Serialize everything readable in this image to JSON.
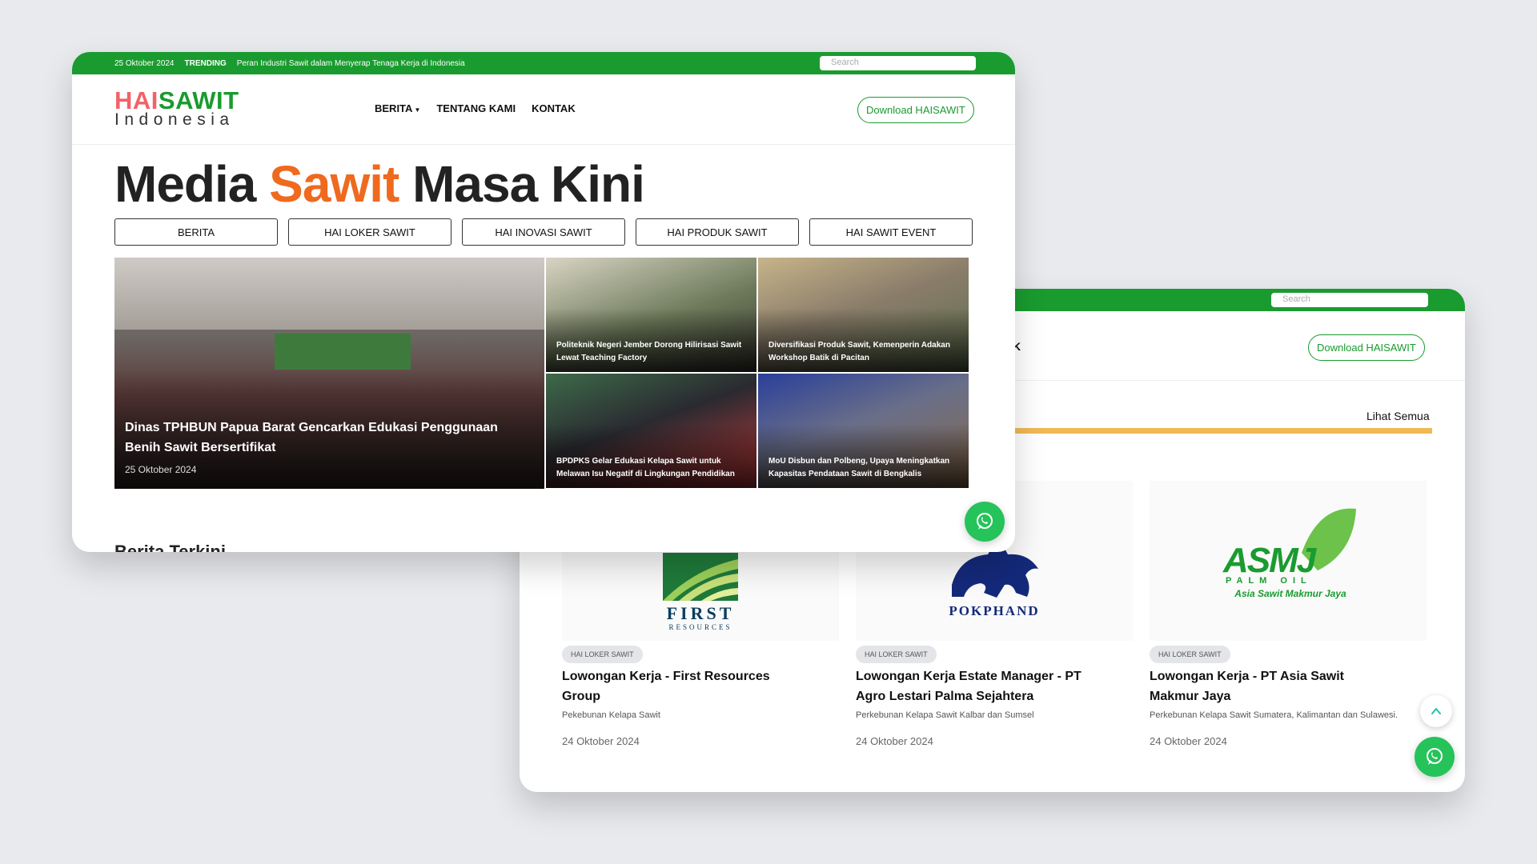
{
  "colors": {
    "brand_green": "#1a9b2f",
    "brand_orange": "#ef6a1e",
    "logo_red": "#f1626a",
    "accent_yellow": "#f0b955",
    "whatsapp_green": "#25c35a"
  },
  "front": {
    "topbar": {
      "date": "25 Oktober 2024",
      "trending_label": "TRENDING",
      "trending_text": "Peran Industri Sawit dalam Menyerap Tenaga Kerja di Indonesia",
      "search_placeholder": "Search"
    },
    "logo": {
      "hai": "HAI",
      "sawit": "SAWIT",
      "sub": "Indonesia"
    },
    "nav": {
      "berita": "BERITA",
      "tentang": "TENTANG KAMI",
      "kontak": "KONTAK",
      "caret_icon": "caret-down-icon"
    },
    "download_label": "Download HAISAWIT",
    "hero": {
      "part1": "Media ",
      "part2": "Sawit",
      "part3": " Masa Kini"
    },
    "categories": [
      "BERITA",
      "HAI LOKER SAWIT",
      "HAI INOVASI SAWIT",
      "HAI PRODUK SAWIT",
      "HAI SAWIT EVENT"
    ],
    "main_news": {
      "title": "Dinas TPHBUN Papua Barat Gencarkan Edukasi Penggunaan Benih Sawit Bersertifikat",
      "date": "25 Oktober 2024"
    },
    "tiles": [
      "Politeknik Negeri Jember Dorong Hilirisasi Sawit Lewat Teaching Factory",
      "Diversifikasi Produk Sawit, Kemenperin Adakan Workshop Batik di Pacitan",
      "BPDPKS Gelar Edukasi Kelapa Sawit untuk Melawan Isu Negatif di Lingkungan Pendidikan",
      "MoU Disbun dan Polbeng, Upaya Meningkatkan Kapasitas Pendataan Sawit di Bengkalis"
    ],
    "section_cut": "Berita Terkini"
  },
  "back": {
    "search_placeholder": "Search",
    "nav_fragment": "K",
    "download_label": "Download HAISAWIT",
    "see_all": "Lihat Semua",
    "jobs": [
      {
        "logo_text": "FIRST",
        "logo_sub": "RESOURCES",
        "badge": "HAI LOKER SAWIT",
        "title": "Lowongan Kerja - First Resources Group",
        "subtitle": "Pekebunan Kelapa Sawit",
        "date": "24 Oktober 2024"
      },
      {
        "logo_text": "POKPHAND",
        "badge": "HAI LOKER SAWIT",
        "title": "Lowongan Kerja Estate Manager - PT Agro Lestari Palma Sejahtera",
        "subtitle": "Perkebunan Kelapa Sawit Kalbar dan Sumsel",
        "date": "24 Oktober 2024"
      },
      {
        "logo_text": "ASMJ",
        "logo_mid": "PALM OIL",
        "logo_sub": "Asia Sawit Makmur Jaya",
        "badge": "HAI LOKER SAWIT",
        "title": "Lowongan Kerja - PT Asia Sawit Makmur Jaya",
        "subtitle": "Perkebunan Kelapa Sawit Sumatera, Kalimantan dan Sulawesi.",
        "date": "24 Oktober 2024"
      }
    ]
  }
}
